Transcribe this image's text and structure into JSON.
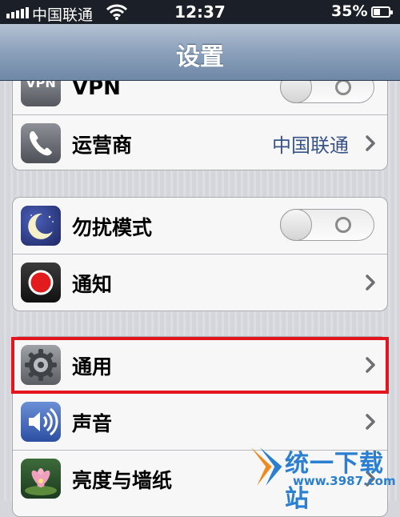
{
  "status_bar": {
    "carrier": "中国联通",
    "time": "12:37",
    "battery": "35%"
  },
  "nav": {
    "title": "设置"
  },
  "groups": [
    {
      "rows": [
        {
          "label": "VPN",
          "icon": "vpn-icon",
          "icon_text": "VPN",
          "accessory": "toggle",
          "toggle_on": false
        },
        {
          "label": "运营商",
          "icon": "phone-icon",
          "accessory": "chevron",
          "value": "中国联通"
        }
      ]
    },
    {
      "rows": [
        {
          "label": "勿扰模式",
          "icon": "moon-icon",
          "accessory": "toggle",
          "toggle_on": false
        },
        {
          "label": "通知",
          "icon": "notification-icon",
          "accessory": "chevron"
        }
      ]
    },
    {
      "rows": [
        {
          "label": "通用",
          "icon": "gear-icon",
          "accessory": "chevron",
          "highlighted": true
        },
        {
          "label": "声音",
          "icon": "speaker-icon",
          "accessory": "chevron"
        },
        {
          "label": "亮度与墙纸",
          "icon": "flower-icon",
          "accessory": "chevron"
        }
      ]
    }
  ],
  "watermark": {
    "name": "统一下载站",
    "url": "www.3987.com"
  },
  "colors": {
    "highlight": "#e3151e",
    "value_text": "#385487",
    "nav_bar": "#8ea3bd"
  }
}
